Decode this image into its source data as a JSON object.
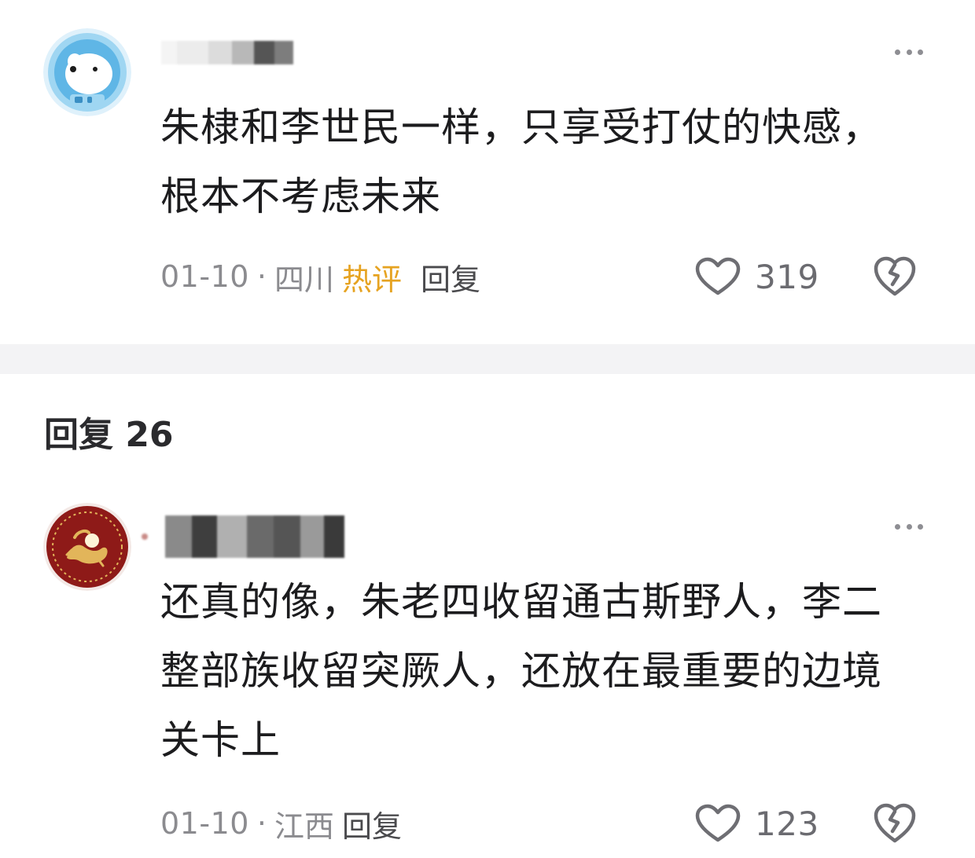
{
  "comments": [
    {
      "avatar_icon": "polar-bear-astronaut-avatar",
      "text_line1": "朱棣和李世民一样，只享受打仗的快感，",
      "text_line2": "根本不考虑未来",
      "date": "01-10",
      "separator": "·",
      "location": "四川",
      "hot_badge": "热评",
      "reply_label": "回复",
      "likes": "319"
    },
    {
      "avatar_icon": "dragon-emblem-avatar",
      "text_line1": "还真的像，朱老四收留通古斯野人，李二",
      "text_line2": "整部族收留突厥人，还放在最重要的边境",
      "text_line3": "关卡上",
      "date": "01-10",
      "separator": "·",
      "location": "江西",
      "reply_label": "回复",
      "likes": "123"
    }
  ],
  "replies_section": {
    "title": "回复 26"
  },
  "colors": {
    "hot_badge": "#e6a321",
    "meta_text": "#8b8b8f",
    "icon_gray": "#6e6e73",
    "divider": "#f3f3f5"
  }
}
